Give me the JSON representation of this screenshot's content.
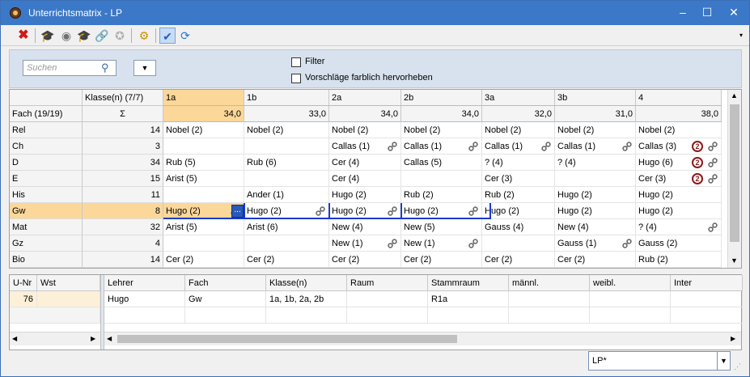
{
  "window": {
    "title": "Unterrichtsmatrix - LP"
  },
  "search": {
    "placeholder": "Suchen"
  },
  "filter": {
    "filter_label": "Filter",
    "highlight_label": "Vorschläge farblich hervorheben"
  },
  "matrix": {
    "corner1": "Klasse(n) (7/7)",
    "corner2": "Fach (19/19)",
    "sigma": "Σ",
    "classes": [
      {
        "name": "1a",
        "total": "34,0"
      },
      {
        "name": "1b",
        "total": "33,0"
      },
      {
        "name": "2a",
        "total": "34,0"
      },
      {
        "name": "2b",
        "total": "34,0"
      },
      {
        "name": "3a",
        "total": "32,0"
      },
      {
        "name": "3b",
        "total": "31,0"
      },
      {
        "name": "4",
        "total": "38,0"
      }
    ],
    "rows": [
      {
        "subject": "Rel",
        "sum": "14",
        "cells": [
          {
            "t": "Nobel (2)"
          },
          {
            "t": "Nobel (2)"
          },
          {
            "t": "Nobel (2)"
          },
          {
            "t": "Nobel (2)"
          },
          {
            "t": "Nobel (2)"
          },
          {
            "t": "Nobel (2)"
          },
          {
            "t": "Nobel (2)"
          }
        ]
      },
      {
        "subject": "Ch",
        "sum": "3",
        "cells": [
          {
            "t": ""
          },
          {
            "t": ""
          },
          {
            "t": "Callas (1)",
            "l": true
          },
          {
            "t": "Callas (1)",
            "l": true
          },
          {
            "t": "Callas (1)",
            "l": true
          },
          {
            "t": "Callas (1)",
            "l": true
          },
          {
            "t": "Callas (3)",
            "l": true,
            "b": "2"
          }
        ]
      },
      {
        "subject": "D",
        "sum": "34",
        "cells": [
          {
            "t": "Rub (5)"
          },
          {
            "t": "Rub (6)"
          },
          {
            "t": "Cer (4)"
          },
          {
            "t": "Callas (5)"
          },
          {
            "t": "? (4)"
          },
          {
            "t": "? (4)"
          },
          {
            "t": "Hugo (6)",
            "l": true,
            "b": "2"
          }
        ]
      },
      {
        "subject": "E",
        "sum": "15",
        "cells": [
          {
            "t": "Arist (5)"
          },
          {
            "t": ""
          },
          {
            "t": "Cer (4)"
          },
          {
            "t": ""
          },
          {
            "t": "Cer (3)"
          },
          {
            "t": ""
          },
          {
            "t": "Cer (3)",
            "l": true,
            "b": "2"
          }
        ]
      },
      {
        "subject": "His",
        "sum": "11",
        "cells": [
          {
            "t": ""
          },
          {
            "t": "Ander (1)"
          },
          {
            "t": "Hugo (2)"
          },
          {
            "t": "Rub (2)"
          },
          {
            "t": "Rub (2)"
          },
          {
            "t": "Hugo (2)"
          },
          {
            "t": "Hugo (2)"
          }
        ]
      },
      {
        "subject": "Gw",
        "sum": "8",
        "cells": [
          {
            "t": "Hugo (2)",
            "l": true,
            "e": "..."
          },
          {
            "t": "Hugo (2)",
            "l": true
          },
          {
            "t": "Hugo (2)",
            "l": true
          },
          {
            "t": "Hugo (2)",
            "l": true
          },
          {
            "t": "Hugo (2)"
          },
          {
            "t": "Hugo (2)"
          },
          {
            "t": "Hugo (2)"
          }
        ]
      },
      {
        "subject": "Mat",
        "sum": "32",
        "cells": [
          {
            "t": "Arist (5)"
          },
          {
            "t": "Arist (6)"
          },
          {
            "t": "New (4)"
          },
          {
            "t": "New (5)"
          },
          {
            "t": "Gauss (4)"
          },
          {
            "t": "New (4)"
          },
          {
            "t": "? (4)",
            "l": true
          }
        ]
      },
      {
        "subject": "Gz",
        "sum": "4",
        "cells": [
          {
            "t": ""
          },
          {
            "t": ""
          },
          {
            "t": "New (1)",
            "l": true
          },
          {
            "t": "New (1)",
            "l": true
          },
          {
            "t": ""
          },
          {
            "t": "Gauss (1)",
            "l": true
          },
          {
            "t": "Gauss (2)"
          }
        ]
      },
      {
        "subject": "Bio",
        "sum": "14",
        "cells": [
          {
            "t": "Cer (2)"
          },
          {
            "t": "Cer (2)"
          },
          {
            "t": "Cer (2)"
          },
          {
            "t": "Cer (2)"
          },
          {
            "t": "Cer (2)"
          },
          {
            "t": "Cer (2)"
          },
          {
            "t": "Rub (2)"
          }
        ]
      }
    ]
  },
  "details": {
    "left_headers": [
      "U-Nr",
      "Wst"
    ],
    "left_row": [
      "76",
      ""
    ],
    "headers": [
      "Lehrer",
      "Fach",
      "Klasse(n)",
      "Raum",
      "Stammraum",
      "männl.",
      "weibl.",
      "Inter"
    ],
    "row": [
      "Hugo",
      "Gw",
      "1a, 1b, 2a, 2b",
      "",
      "R1a",
      "",
      "",
      ""
    ]
  },
  "status": {
    "combo_value": "LP*"
  },
  "colors": {
    "titlebar": "#3c78c8",
    "selection": "#fcd79a",
    "highlight_border": "#1a3ad0",
    "badge": "#8a1a1a"
  }
}
